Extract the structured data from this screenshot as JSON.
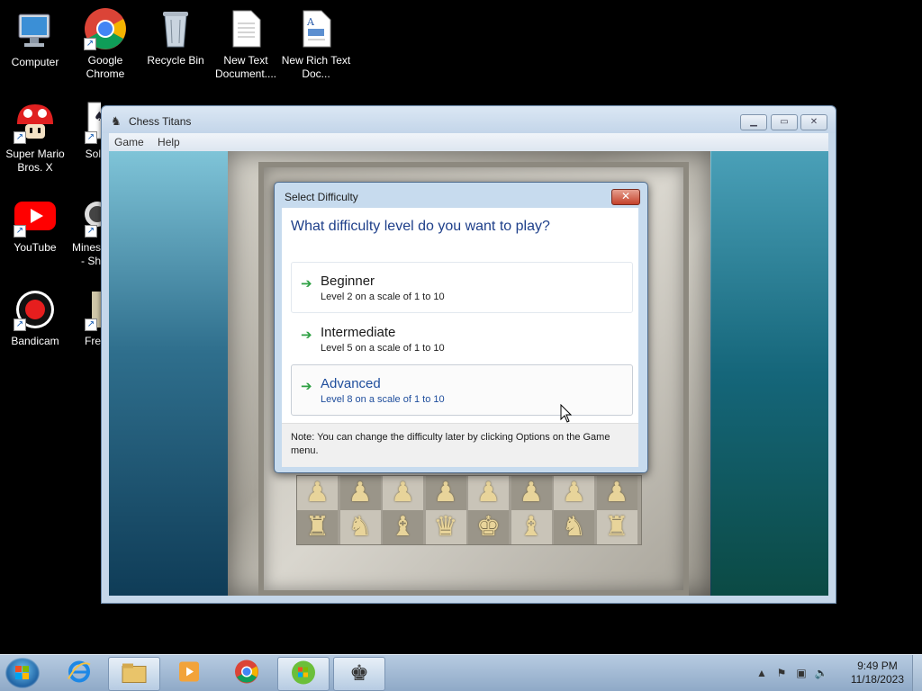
{
  "desktop": {
    "icons": [
      {
        "label": "Computer"
      },
      {
        "label": "Google Chrome"
      },
      {
        "label": "Recycle Bin"
      },
      {
        "label": "New Text Document...."
      },
      {
        "label": "New Rich Text Doc..."
      },
      {
        "label": "Super Mario Bros. X"
      },
      {
        "label": "Sol"
      },
      {
        "label": "YouTube"
      },
      {
        "label": "Mines - Sh"
      },
      {
        "label": "Bandicam"
      },
      {
        "label": "Fre"
      }
    ]
  },
  "window": {
    "title": "Chess Titans",
    "menu": [
      "Game",
      "Help"
    ]
  },
  "dialog": {
    "title": "Select Difficulty",
    "question": "What difficulty level do you want to play?",
    "options": [
      {
        "name": "Beginner",
        "desc": "Level 2 on a scale of 1 to 10"
      },
      {
        "name": "Intermediate",
        "desc": "Level 5 on a scale of 1 to 10"
      },
      {
        "name": "Advanced",
        "desc": "Level 8 on a scale of 1 to 10"
      }
    ],
    "note": "Note: You can change the difficulty later by clicking Options on the Game menu."
  },
  "board": {
    "pawns": [
      "♟",
      "♟",
      "♟",
      "♟",
      "♟",
      "♟",
      "♟",
      "♟"
    ],
    "back_rank": [
      "♜",
      "♞",
      "♝",
      "♛",
      "♚",
      "♝",
      "♞",
      "♜"
    ]
  },
  "taskbar": {
    "time": "9:49 PM",
    "date": "11/18/2023"
  },
  "colors": {
    "accent_link": "#1e4d9c",
    "question_text": "#1e3f8a",
    "arrow_green": "#2ea043"
  }
}
